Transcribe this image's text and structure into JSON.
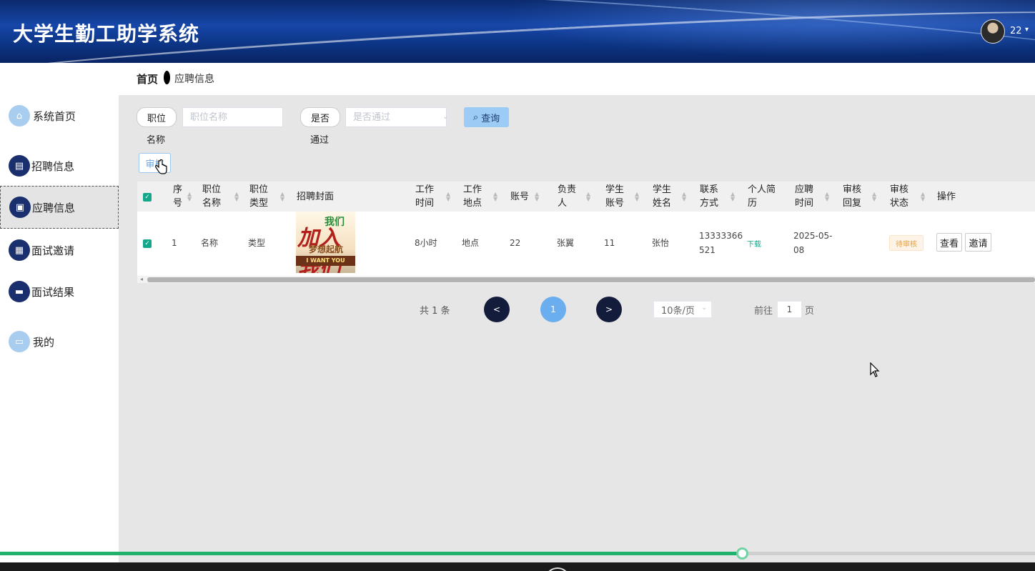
{
  "app": {
    "title": "大学生勤工助学系统"
  },
  "user": {
    "name": "22",
    "caret": "▾"
  },
  "sidebar": {
    "items": [
      {
        "label": "系统首页",
        "icon": "home-icon",
        "glyph": "⌂"
      },
      {
        "label": "招聘信息",
        "icon": "clipboard-icon",
        "glyph": "▤"
      },
      {
        "label": "应聘信息",
        "icon": "document-icon",
        "glyph": "▣"
      },
      {
        "label": "面试邀请",
        "icon": "grid-icon",
        "glyph": "▦"
      },
      {
        "label": "面试结果",
        "icon": "briefcase-icon",
        "glyph": "▬"
      },
      {
        "label": "我的",
        "icon": "card-icon",
        "glyph": "▭"
      }
    ],
    "active_index": 2
  },
  "breadcrumb": {
    "home": "首页",
    "current": "应聘信息"
  },
  "search": {
    "field1_label_top": "职位",
    "field1_label_bottom": "名称",
    "field1_placeholder": "职位名称",
    "field2_label_top": "是否",
    "field2_label_bottom": "通过",
    "field2_placeholder": "是否通过",
    "query_label": "查询",
    "query_icon": "⌕",
    "audit_label": "审核"
  },
  "table": {
    "headers": [
      "序号",
      "职位名称",
      "职位类型",
      "招聘封面",
      "工作时间",
      "工作地点",
      "账号",
      "负责人",
      "学生账号",
      "学生姓名",
      "联系方式",
      "个人简历",
      "应聘时间",
      "审核回复",
      "审核状态",
      "操作"
    ],
    "header_lines": {
      "seq": [
        "序",
        "号"
      ],
      "job_name": [
        "职位",
        "名称"
      ],
      "job_type": [
        "职位",
        "类型"
      ],
      "cover": [
        "招聘封面"
      ],
      "work_time": [
        "工作",
        "时间"
      ],
      "work_place": [
        "工作",
        "地点"
      ],
      "account": [
        "账号"
      ],
      "manager": [
        "负责",
        "人"
      ],
      "stu_account": [
        "学生",
        "账号"
      ],
      "stu_name": [
        "学生",
        "姓名"
      ],
      "contact": [
        "联系",
        "方式"
      ],
      "resume": [
        "个人简",
        "历"
      ],
      "apply_time": [
        "应聘",
        "时间"
      ],
      "reply": [
        "审核",
        "回复"
      ],
      "status": [
        "审核",
        "状态"
      ],
      "ops": [
        "操作"
      ]
    },
    "rows": [
      {
        "seq": "1",
        "job_name": "名称",
        "job_type": "类型",
        "cover_text_main": "加入我们",
        "cover_text_top": "我们",
        "cover_text_mid": "梦想起航",
        "cover_text_banner": "I WANT YOU",
        "work_time": "8小时",
        "work_place": "地点",
        "account": "22",
        "manager": "张翼",
        "stu_account": "11",
        "stu_name": "张怡",
        "contact_line1": "13333366",
        "contact_line2": "521",
        "resume_link": "下载",
        "apply_time_line1": "2025-05-",
        "apply_time_line2": "08",
        "reply": "",
        "status": "待审核",
        "btn_view": "查看",
        "btn_invite": "邀请"
      }
    ]
  },
  "pagination": {
    "total_text": "共 1 条",
    "prev": "<",
    "current_page": "1",
    "next": ">",
    "page_size": "10条/页",
    "goto_label": "前往",
    "goto_value": "1",
    "page_suffix": "页"
  },
  "video": {
    "progress": 0.717
  },
  "colors": {
    "accent": "#13a889",
    "nav_dark": "#141c3c",
    "page_current": "#6aaef0",
    "status_pending": "#e6a23c"
  }
}
